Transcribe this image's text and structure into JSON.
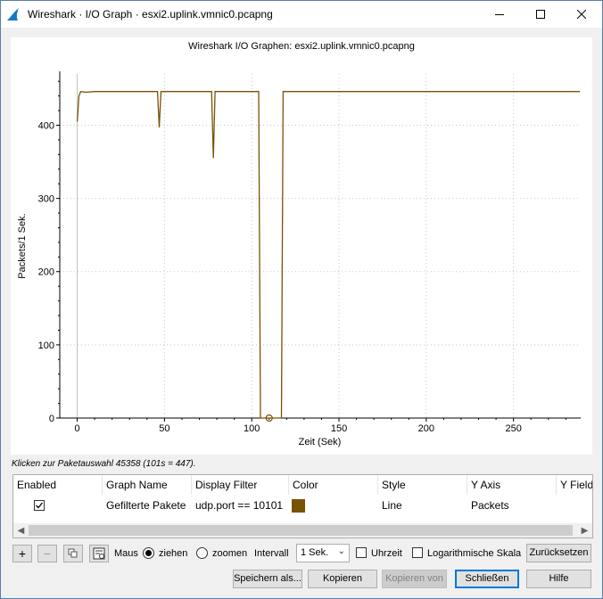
{
  "window": {
    "title": "Wireshark · I/O Graph · esxi2.uplink.vmnic0.pcapng",
    "controls": {
      "minimize": "minimize-icon",
      "maximize": "maximize-icon",
      "close": "close-icon"
    }
  },
  "chart_data": {
    "type": "line",
    "title": "Wireshark I/O Graphen: esxi2.uplink.vmnic0.pcapng",
    "xlabel": "Zeit (Sek)",
    "ylabel": "Packets/1 Sek.",
    "xlim": [
      -10,
      288
    ],
    "ylim": [
      0,
      470
    ],
    "xticks": [
      0,
      50,
      100,
      150,
      200,
      250
    ],
    "yticks": [
      0,
      100,
      200,
      300,
      400
    ],
    "grid": true,
    "series": [
      {
        "color": "#7a5205",
        "x": [
          0,
          1,
          2,
          5,
          10,
          20,
          30,
          40,
          46,
          47,
          48,
          50,
          60,
          70,
          77,
          78,
          79,
          80,
          90,
          100,
          104,
          105,
          106,
          108,
          110,
          112,
          114,
          116,
          117,
          118,
          120,
          140,
          160,
          180,
          200,
          220,
          240,
          260,
          280,
          288
        ],
        "y": [
          405,
          440,
          446,
          445,
          446,
          446,
          446,
          446,
          446,
          397,
          446,
          446,
          446,
          446,
          446,
          355,
          446,
          446,
          446,
          446,
          446,
          0,
          0,
          0,
          0,
          0,
          0,
          0,
          0,
          446,
          446,
          446,
          446,
          446,
          446,
          446,
          446,
          446,
          446,
          446
        ]
      }
    ],
    "marker": {
      "x": 110,
      "y": 0
    }
  },
  "hint": "Klicken zur Paketauswahl 45358 (101s = 447).",
  "table": {
    "headers": [
      "Enabled",
      "Graph Name",
      "Display Filter",
      "Color",
      "Style",
      "Y Axis",
      "Y Field"
    ],
    "rows": [
      {
        "enabled": true,
        "graph_name": "Gefilterte Pakete",
        "display_filter": "udp.port == 10101",
        "color": "#7a5205",
        "style": "Line",
        "y_axis": "Packets"
      }
    ]
  },
  "toolbar": {
    "add": "+",
    "remove": "−",
    "mouse_label": "Maus",
    "drag_label": "ziehen",
    "zoom_label": "zoomen",
    "mouse_mode": "ziehen",
    "interval_label": "Intervall",
    "interval_value": "1 Sek.",
    "time_of_day_label": "Uhrzeit",
    "time_of_day_checked": false,
    "log_scale_label": "Logarithmische Skala",
    "log_scale_checked": false,
    "reset": "Zurücksetzen"
  },
  "buttons": {
    "save_as": "Speichern als...",
    "copy": "Kopieren",
    "copy_from": "Kopieren von",
    "close": "Schließen",
    "help": "Hilfe"
  }
}
